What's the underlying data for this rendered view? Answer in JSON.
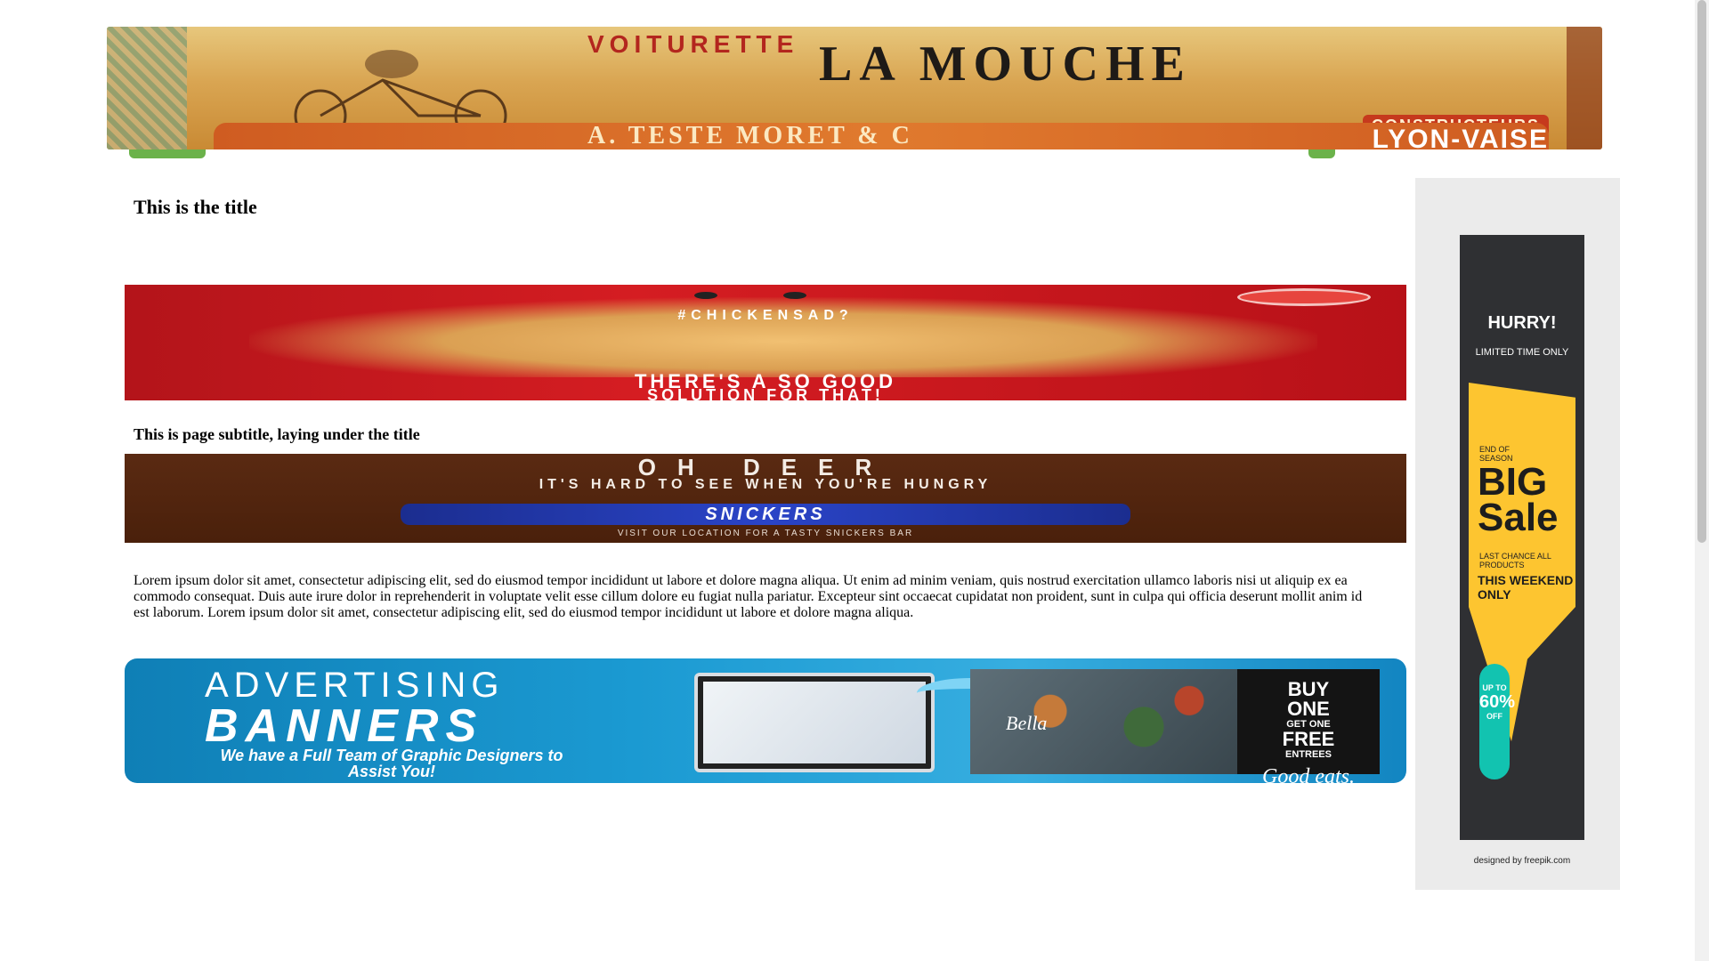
{
  "banner": {
    "headline_small": "VOITURETTE",
    "headline": "LA MOUCHE",
    "bottom_text": "A. TESTE MORET & C",
    "constructeurs": "CONSTRUCTEURS",
    "city": "LYON-VAISE"
  },
  "page": {
    "title": "This is the title",
    "subtitle": "This is page subtitle, laying under the title",
    "body": "Lorem ipsum dolor sit amet, consectetur adipiscing elit, sed do eiusmod tempor incididunt ut labore et dolore magna aliqua. Ut enim ad minim veniam, quis nostrud exercitation ullamco laboris nisi ut aliquip ex ea commodo consequat. Duis aute irure dolor in reprehenderit in voluptate velit esse cillum dolore eu fugiat nulla pariatur. Excepteur sint occaecat cupidatat non proident, sunt in culpa qui officia deserunt mollit anim id est laborum. Lorem ipsum dolor sit amet, consectetur adipiscing elit, sed do eiusmod tempor incididunt ut labore et dolore magna aliqua."
  },
  "ad_chicken": {
    "hashtag": "#CHICKENSAD?",
    "line1": "THERE'S A SO GOOD",
    "line2": "SOLUTION FOR THAT!"
  },
  "ad_snickers": {
    "big": "OH DEER",
    "mid": "IT'S HARD TO SEE WHEN YOU'RE HUNGRY",
    "brand": "SNICKERS",
    "tag": "VISIT OUR LOCATION FOR A TASTY SNICKERS BAR"
  },
  "ad_advertising": {
    "line1": "ADVERTISING",
    "line2": "BANNERS",
    "line3": "We have a Full Team of Graphic Designers to Assist You!",
    "restaurant": "Bella",
    "offer_buy": "BUY",
    "offer_one": "ONE",
    "offer_get": "GET ONE",
    "offer_free": "FREE",
    "offer_entrees": "ENTREES",
    "offer_tagline": "Good eats."
  },
  "sidebar_ad": {
    "hurry": "HURRY!",
    "limited": "LIMITED TIME ONLY",
    "season": "END OF SEASON",
    "big_sale": "BIG Sale",
    "last_chance": "LAST CHANCE   ALL PRODUCTS",
    "weekend": "THIS WEEKEND ONLY",
    "upto": "UP TO",
    "percent": "60%",
    "off": "OFF",
    "credit": "designed by freepik.com"
  },
  "colors": {
    "sale_yellow": "#fdc530",
    "sale_teal": "#12c3b0",
    "chicken_red": "#c8161c",
    "snickers_brown": "#4f230d",
    "advert_blue": "#1b9ad2"
  }
}
